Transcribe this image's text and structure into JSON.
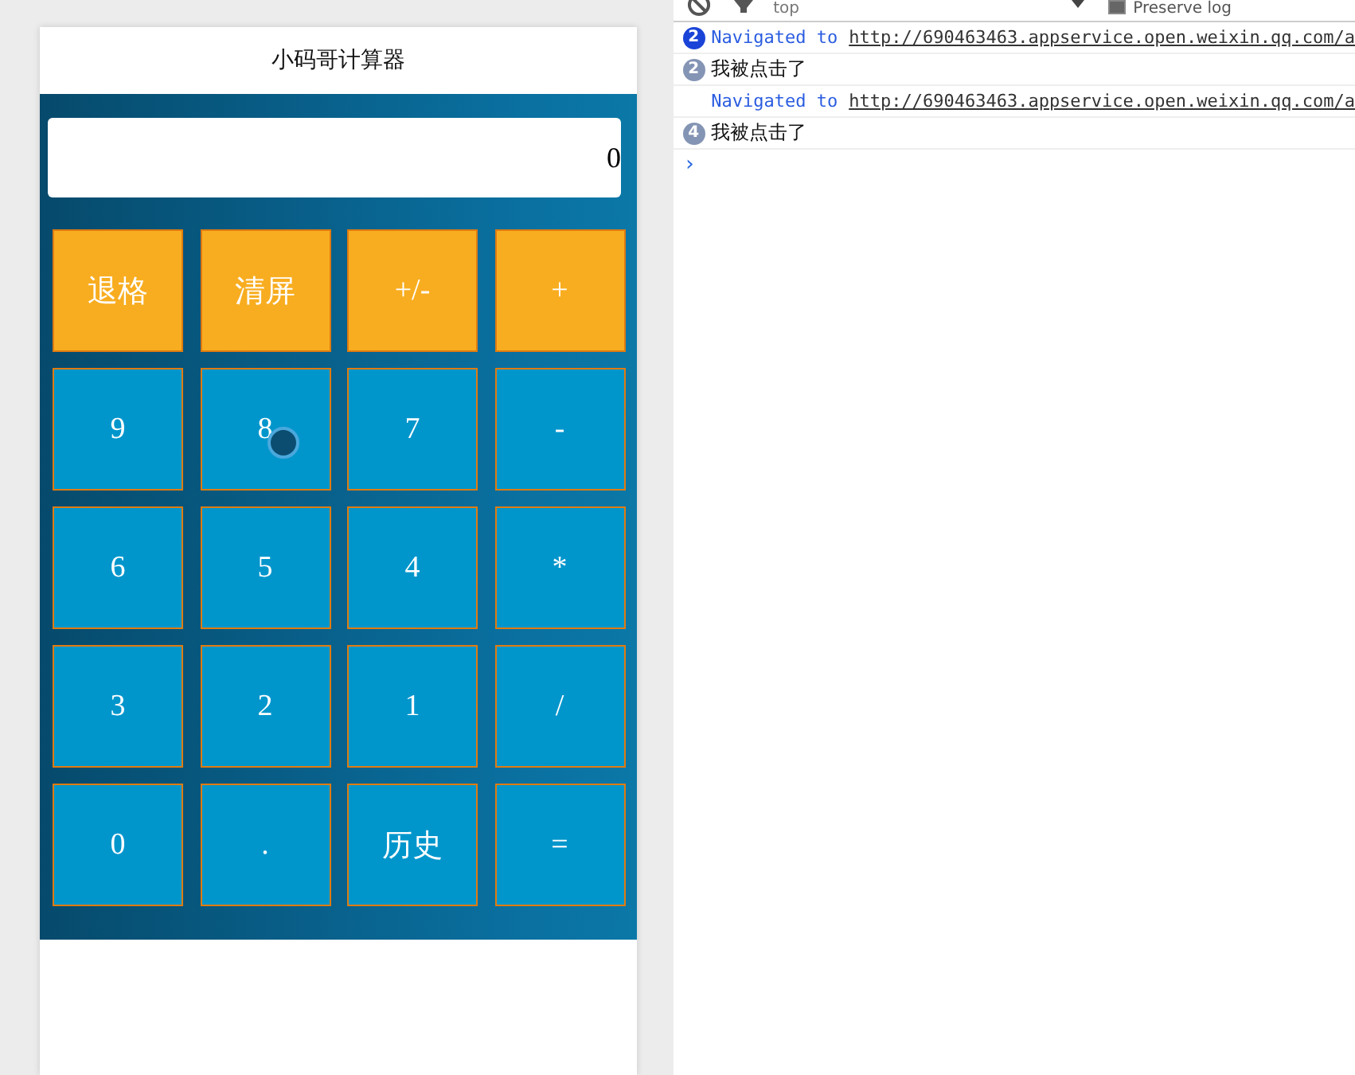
{
  "app": {
    "title": "小码哥计算器",
    "display": "0",
    "buttons": [
      {
        "label": "退格",
        "kind": "op"
      },
      {
        "label": "清屏",
        "kind": "op"
      },
      {
        "label": "+/-",
        "kind": "op"
      },
      {
        "label": "+",
        "kind": "op"
      },
      {
        "label": "9",
        "kind": "num"
      },
      {
        "label": "8",
        "kind": "num"
      },
      {
        "label": "7",
        "kind": "num"
      },
      {
        "label": "-",
        "kind": "num"
      },
      {
        "label": "6",
        "kind": "num"
      },
      {
        "label": "5",
        "kind": "num"
      },
      {
        "label": "4",
        "kind": "num"
      },
      {
        "label": "*",
        "kind": "num"
      },
      {
        "label": "3",
        "kind": "num"
      },
      {
        "label": "2",
        "kind": "num"
      },
      {
        "label": "1",
        "kind": "num"
      },
      {
        "label": "/",
        "kind": "num"
      },
      {
        "label": "0",
        "kind": "num"
      },
      {
        "label": ".",
        "kind": "num"
      },
      {
        "label": "历史",
        "kind": "num"
      },
      {
        "label": "=",
        "kind": "num"
      }
    ]
  },
  "console": {
    "context": "top",
    "preserve_log": {
      "label": "Preserve log",
      "checked": true
    },
    "messages": [
      {
        "kind": "navigated",
        "count": "2",
        "text": "Navigated to",
        "url": "http://690463463.appservice.open.weixin.qq.com/a"
      },
      {
        "kind": "log",
        "count": "2",
        "text": "我被点击了"
      },
      {
        "kind": "navigated",
        "text": "Navigated to",
        "url": "http://690463463.appservice.open.weixin.qq.com/a"
      },
      {
        "kind": "log",
        "count": "4",
        "text": "我被点击了"
      }
    ],
    "prompt": "›"
  }
}
